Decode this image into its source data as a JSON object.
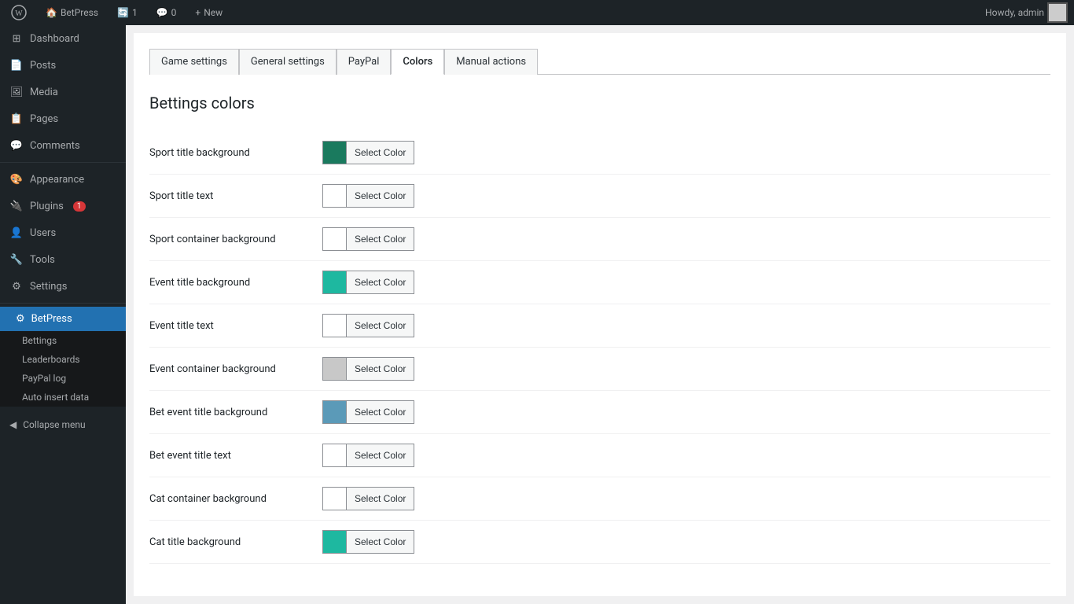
{
  "topbar": {
    "logo_alt": "WordPress",
    "site_name": "BetPress",
    "updates_count": "1",
    "comments_count": "0",
    "new_label": "New",
    "howdy": "Howdy, admin"
  },
  "sidebar": {
    "items": [
      {
        "id": "dashboard",
        "label": "Dashboard",
        "icon": "⊞"
      },
      {
        "id": "posts",
        "label": "Posts",
        "icon": "📄"
      },
      {
        "id": "media",
        "label": "Media",
        "icon": "🖼"
      },
      {
        "id": "pages",
        "label": "Pages",
        "icon": "📋"
      },
      {
        "id": "comments",
        "label": "Comments",
        "icon": "💬"
      },
      {
        "id": "appearance",
        "label": "Appearance",
        "icon": "🎨"
      },
      {
        "id": "plugins",
        "label": "Plugins",
        "icon": "🔌",
        "badge": "1"
      },
      {
        "id": "users",
        "label": "Users",
        "icon": "👤"
      },
      {
        "id": "tools",
        "label": "Tools",
        "icon": "🔧"
      },
      {
        "id": "settings",
        "label": "Settings",
        "icon": "⚙"
      }
    ],
    "betpress_label": "BetPress",
    "betpress_submenu": [
      {
        "id": "bettings",
        "label": "Bettings"
      },
      {
        "id": "leaderboards",
        "label": "Leaderboards"
      },
      {
        "id": "paypal-log",
        "label": "PayPal log"
      },
      {
        "id": "auto-insert",
        "label": "Auto insert data"
      }
    ],
    "collapse_label": "Collapse menu"
  },
  "tabs": [
    {
      "id": "game-settings",
      "label": "Game settings"
    },
    {
      "id": "general-settings",
      "label": "General settings"
    },
    {
      "id": "paypal",
      "label": "PayPal"
    },
    {
      "id": "colors",
      "label": "Colors",
      "active": true
    },
    {
      "id": "manual-actions",
      "label": "Manual actions"
    }
  ],
  "page_title": "Bettings colors",
  "color_rows": [
    {
      "id": "sport-title-bg",
      "label": "Sport title background",
      "swatch": "#1a7a5e",
      "btn_label": "Select Color"
    },
    {
      "id": "sport-title-text",
      "label": "Sport title text",
      "swatch": "#ffffff",
      "btn_label": "Select Color"
    },
    {
      "id": "sport-container-bg",
      "label": "Sport container background",
      "swatch": "#ffffff",
      "btn_label": "Select Color"
    },
    {
      "id": "event-title-bg",
      "label": "Event title background",
      "swatch": "#1eb8a0",
      "btn_label": "Select Color"
    },
    {
      "id": "event-title-text",
      "label": "Event title text",
      "swatch": "#ffffff",
      "btn_label": "Select Color"
    },
    {
      "id": "event-container-bg",
      "label": "Event container background",
      "swatch": "#c8c8c8",
      "btn_label": "Select Color"
    },
    {
      "id": "bet-event-title-bg",
      "label": "Bet event title background",
      "swatch": "#5b9ab8",
      "btn_label": "Select Color"
    },
    {
      "id": "bet-event-title-text",
      "label": "Bet event title text",
      "swatch": "#ffffff",
      "btn_label": "Select Color"
    },
    {
      "id": "cat-container-bg",
      "label": "Cat container background",
      "swatch": "#ffffff",
      "btn_label": "Select Color"
    },
    {
      "id": "cat-title-bg",
      "label": "Cat title background",
      "swatch": "#1eb8a0",
      "btn_label": "Select Color"
    }
  ]
}
